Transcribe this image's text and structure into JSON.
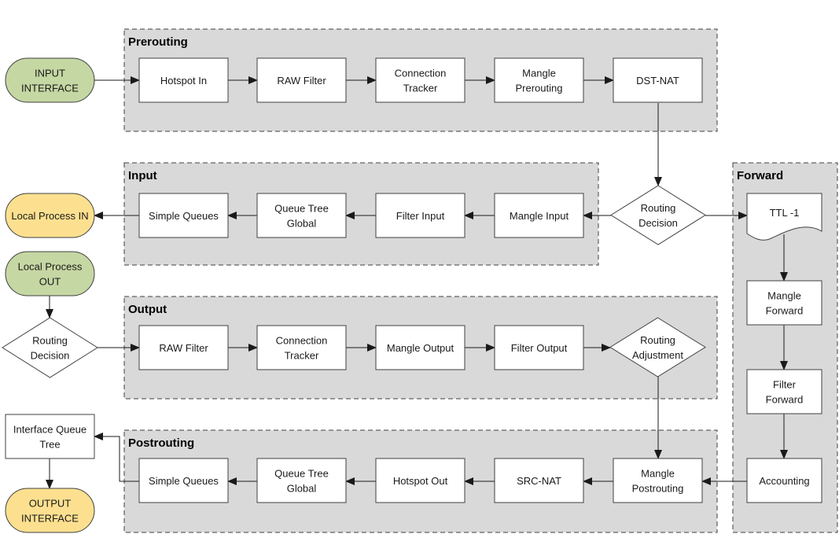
{
  "groups": {
    "prerouting": "Prerouting",
    "input": "Input",
    "forward": "Forward",
    "output": "Output",
    "postrouting": "Postrouting"
  },
  "nodes": {
    "input_interface": [
      "INPUT",
      "INTERFACE"
    ],
    "pre_hotspot_in": [
      "Hotspot In"
    ],
    "pre_raw_filter": [
      "RAW Filter"
    ],
    "pre_conn_tracker": [
      "Connection",
      "Tracker"
    ],
    "pre_mangle": [
      "Mangle",
      "Prerouting"
    ],
    "pre_dstnat": [
      "DST-NAT"
    ],
    "routing_decision_1": [
      "Routing",
      "Decision"
    ],
    "in_mangle": [
      "Mangle Input"
    ],
    "in_filter": [
      "Filter Input"
    ],
    "in_queue_tree": [
      "Queue Tree",
      "Global"
    ],
    "in_simple_queues": [
      "Simple Queues"
    ],
    "local_process_in": [
      "Local Process IN"
    ],
    "fwd_ttl": [
      "TTL -1"
    ],
    "fwd_mangle": [
      "Mangle",
      "Forward"
    ],
    "fwd_filter": [
      "Filter",
      "Forward"
    ],
    "fwd_accounting": [
      "Accounting"
    ],
    "local_process_out": [
      "Local Process",
      "OUT"
    ],
    "routing_decision_2": [
      "Routing",
      "Decision"
    ],
    "out_raw_filter": [
      "RAW Filter"
    ],
    "out_conn_tracker": [
      "Connection",
      "Tracker"
    ],
    "out_mangle": [
      "Mangle Output"
    ],
    "out_filter": [
      "Filter Output"
    ],
    "routing_adjustment": [
      "Routing",
      "Adjustment"
    ],
    "post_mangle": [
      "Mangle",
      "Postrouting"
    ],
    "post_srcnat": [
      "SRC-NAT"
    ],
    "post_hotspot_out": [
      "Hotspot Out"
    ],
    "post_queue_tree": [
      "Queue Tree",
      "Global"
    ],
    "post_simple_queues": [
      "Simple Queues"
    ],
    "interface_queue_tree": [
      "Interface Queue",
      "Tree"
    ],
    "output_interface": [
      "OUTPUT",
      "INTERFACE"
    ]
  },
  "colors": {
    "group_fill": "#d9d9d9",
    "input_terminal": "#c5d7a3",
    "output_terminal": "#fde08f"
  }
}
